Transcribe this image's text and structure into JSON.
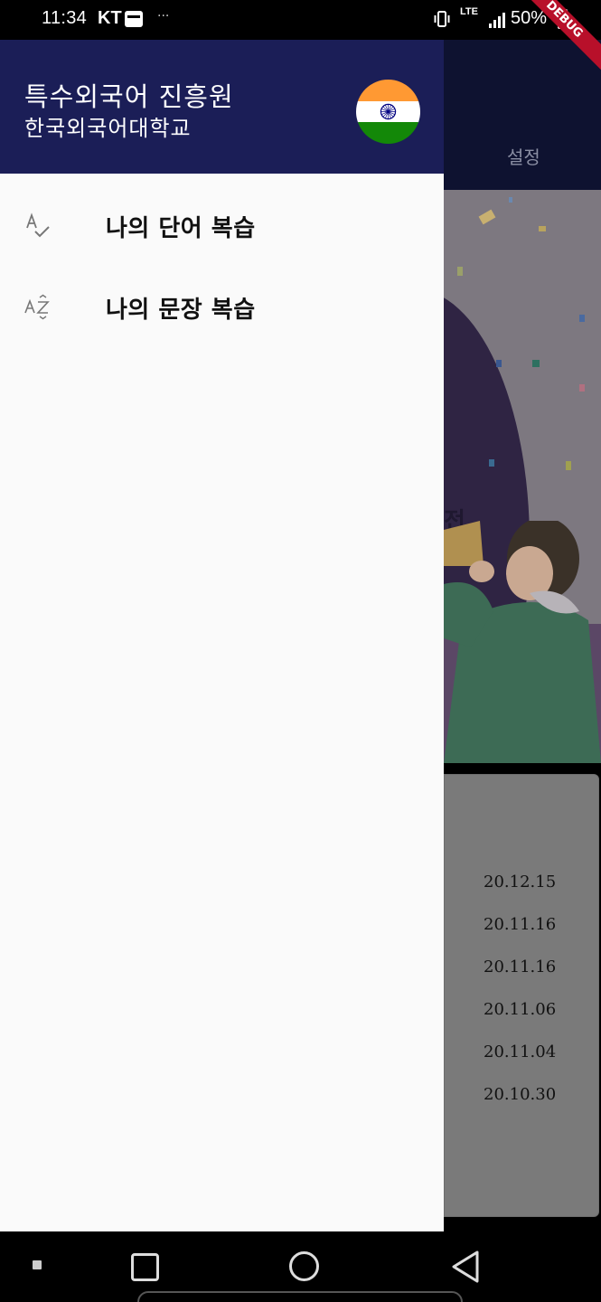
{
  "status_bar": {
    "time": "11:34",
    "carrier": "KT",
    "dots": "···",
    "network": "LTE",
    "battery": "50%",
    "icons": [
      "wallet-icon",
      "vibrate-icon",
      "signal-icon",
      "battery-icon"
    ]
  },
  "debug_banner": "DEBUG",
  "drawer": {
    "title": "특수외국어 진흥원",
    "subtitle": "한국외국어대학교",
    "flag": {
      "name": "india-flag-icon",
      "colors": [
        "#ff9933",
        "#ffffff",
        "#138808"
      ],
      "chakra": "#000080"
    },
    "items": [
      {
        "icon": "spellcheck-icon",
        "label": "나의 단어 복습"
      },
      {
        "icon": "sort-by-alpha-icon",
        "label": "나의 문장 복습"
      }
    ]
  },
  "background_app": {
    "tab_label": "설정",
    "banner_text": "전",
    "dates": [
      "20.12.15",
      "20.11.16",
      "20.11.16",
      "20.11.06",
      "20.11.04",
      "20.10.30"
    ]
  },
  "colors": {
    "drawer_header": "#1b1e57",
    "drawer_bg": "#fafafa",
    "debug": "#b8102a"
  }
}
